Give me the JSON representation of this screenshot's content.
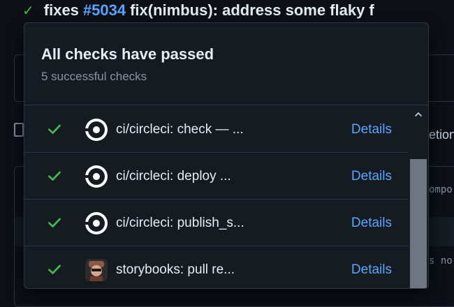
{
  "background": {
    "commit_check_icon": "check-icon",
    "commit_prefix": "fixes",
    "commit_pr": "#5034",
    "commit_message": "fix(nimbus): address some flaky f",
    "tab_text_fragment": "etion",
    "mono_fragment_1": "ompo",
    "mono_fragment_2": "s no"
  },
  "popover": {
    "title": "All checks have passed",
    "subtitle": "5 successful checks",
    "checks": [
      {
        "status_icon": "check-icon",
        "logo": "circleci-logo",
        "name": "ci/circleci: check — ...",
        "details": "Details"
      },
      {
        "status_icon": "check-icon",
        "logo": "circleci-logo",
        "name": "ci/circleci: deploy ...",
        "details": "Details"
      },
      {
        "status_icon": "check-icon",
        "logo": "circleci-logo",
        "name": "ci/circleci: publish_s...",
        "details": "Details"
      },
      {
        "status_icon": "check-icon",
        "logo": "storybooks-avatar",
        "name": "storybooks: pull re...",
        "details": "Details"
      }
    ]
  },
  "colors": {
    "success": "#3fb950",
    "link": "#58a6ff",
    "background": "#0d1117",
    "panel": "#161b22",
    "border": "#30363d"
  }
}
